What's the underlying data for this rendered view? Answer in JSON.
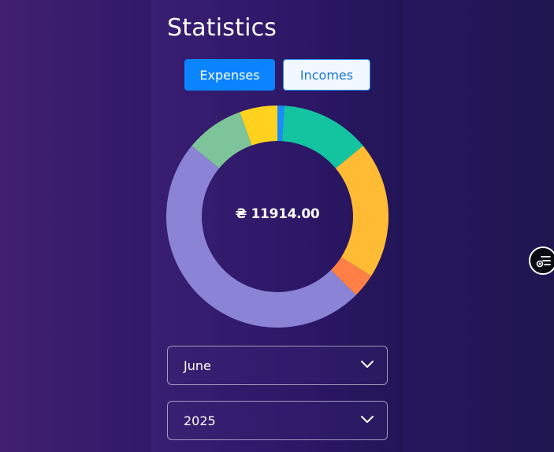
{
  "page": {
    "title": "Statistics"
  },
  "tabs": [
    {
      "label": "Expenses",
      "active": true
    },
    {
      "label": "Incomes",
      "active": false
    }
  ],
  "total": {
    "display": "₴ 11914.00"
  },
  "selects": {
    "month": "June",
    "year": "2025"
  },
  "colors": {
    "accent": "#0a84ff",
    "donut_track": "#8b84d6"
  },
  "chart_data": {
    "type": "pie",
    "title": "",
    "categories": [
      "",
      "",
      "",
      "",
      "",
      "",
      ""
    ],
    "values": [
      1.0,
      13.0,
      20.0,
      3.5,
      48.5,
      8.5,
      5.5
    ],
    "colors": [
      "#1a8cff",
      "#14c4a0",
      "#ffbb33",
      "#ff8046",
      "#8b84d6",
      "#7dc49a",
      "#ffd21f"
    ]
  },
  "icons": {
    "fab": "filter-list-icon",
    "dropdown": "chevron-down-icon"
  }
}
